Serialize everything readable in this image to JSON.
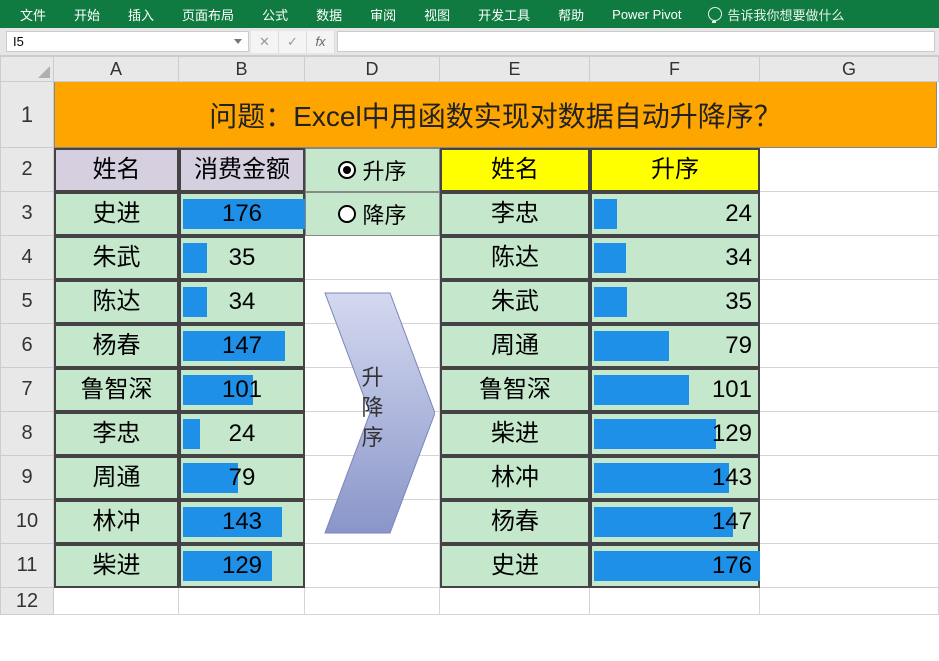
{
  "ribbon": {
    "tabs": [
      "文件",
      "开始",
      "插入",
      "页面布局",
      "公式",
      "数据",
      "审阅",
      "视图",
      "开发工具",
      "帮助",
      "Power Pivot"
    ],
    "tell_me": "告诉我你想要做什么"
  },
  "namebox": "I5",
  "fx": {
    "cancel": "✕",
    "confirm": "✓",
    "fx": "fx"
  },
  "columns": [
    "A",
    "B",
    "D",
    "E",
    "F",
    "G"
  ],
  "row_numbers": [
    "1",
    "2",
    "3",
    "4",
    "5",
    "6",
    "7",
    "8",
    "9",
    "10",
    "11",
    "12"
  ],
  "title": "问题：Excel中用函数实现对数据自动升降序？",
  "left_table": {
    "headers": [
      "姓名",
      "消费金额"
    ],
    "rows": [
      {
        "name": "史进",
        "value": 176
      },
      {
        "name": "朱武",
        "value": 35
      },
      {
        "name": "陈达",
        "value": 34
      },
      {
        "name": "杨春",
        "value": 147
      },
      {
        "name": "鲁智深",
        "value": 101
      },
      {
        "name": "李忠",
        "value": 24
      },
      {
        "name": "周通",
        "value": 79
      },
      {
        "name": "林冲",
        "value": 143
      },
      {
        "name": "柴进",
        "value": 129
      }
    ],
    "max": 176
  },
  "controls": {
    "opt1": "升序",
    "opt2": "降序",
    "selected": "opt1",
    "arrow_label": "升\n降\n序"
  },
  "right_table": {
    "headers": [
      "姓名",
      "升序"
    ],
    "rows": [
      {
        "name": "李忠",
        "value": 24
      },
      {
        "name": "陈达",
        "value": 34
      },
      {
        "name": "朱武",
        "value": 35
      },
      {
        "name": "周通",
        "value": 79
      },
      {
        "name": "鲁智深",
        "value": 101
      },
      {
        "name": "柴进",
        "value": 129
      },
      {
        "name": "林冲",
        "value": 143
      },
      {
        "name": "杨春",
        "value": 147
      },
      {
        "name": "史进",
        "value": 176
      }
    ],
    "max": 176
  }
}
